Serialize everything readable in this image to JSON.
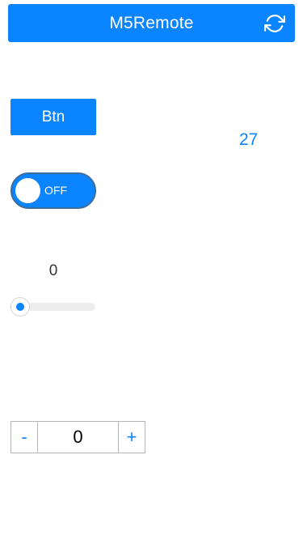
{
  "header": {
    "title": "M5Remote",
    "refresh_icon": "refresh-icon",
    "color": "#0a84ff"
  },
  "controls": {
    "button_label": "Btn",
    "display_value": "27",
    "toggle": {
      "label": "OFF",
      "state": "off"
    },
    "slider": {
      "value": "0",
      "min": 0,
      "max": 100
    },
    "stepper": {
      "minus_label": "-",
      "value": "0",
      "plus_label": "+"
    }
  },
  "colors": {
    "accent": "#0a84ff",
    "track": "#ededed",
    "border": "#b5b5b5"
  }
}
